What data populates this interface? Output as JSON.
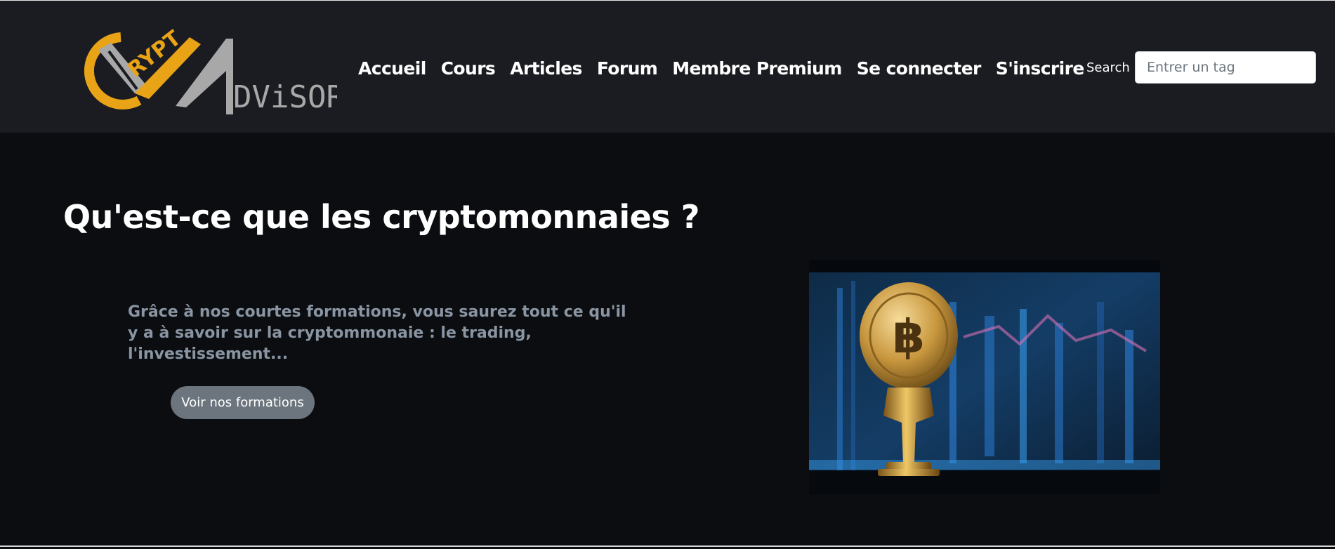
{
  "header": {
    "logo": {
      "text_top": "RYPT",
      "text_bottom": "DViSOR",
      "colors": {
        "gold": "#e8a317",
        "grey": "#a8a8a8"
      }
    },
    "nav": [
      {
        "label": "Accueil"
      },
      {
        "label": "Cours"
      },
      {
        "label": "Articles"
      },
      {
        "label": "Forum"
      },
      {
        "label": "Membre Premium"
      },
      {
        "label": "Se connecter"
      },
      {
        "label": "S'inscrire"
      }
    ],
    "search": {
      "label": "Search :",
      "placeholder": "Entrer un tag"
    }
  },
  "hero": {
    "title": "Qu'est-ce que les cryptomonnaies ?",
    "text": "Grâce à nos courtes formations, vous saurez tout ce qu'il y a à savoir sur la cryptommonaie : le trading, l'investissement...",
    "cta_label": "Voir nos formations",
    "image_icon": "bitcoin-coin-icon"
  },
  "colors": {
    "navbar_bg": "#1b1c21",
    "page_bg": "#0b0d10",
    "muted_text": "#8a95a3",
    "button_bg": "#6c757d"
  }
}
